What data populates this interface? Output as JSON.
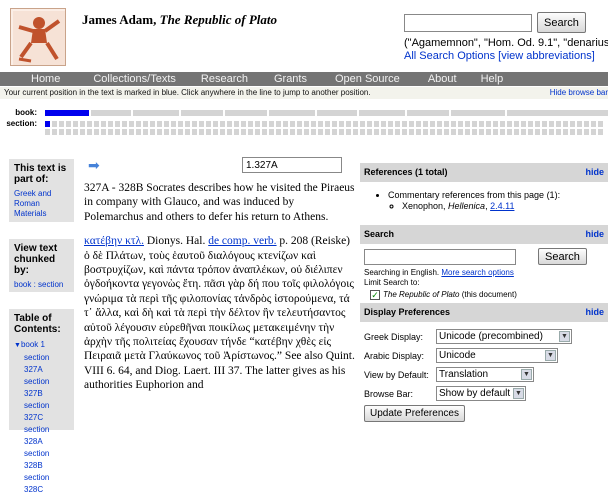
{
  "header": {
    "author": "James Adam, ",
    "work": "The Republic of Plato",
    "search_button": "Search",
    "search_example": "(\"Agamemnon\", \"Hom. Od. 9.1\", \"denarius\")",
    "all_search_options": "All Search Options",
    "view_abbreviations": "[view abbreviations]"
  },
  "nav": [
    "Home",
    "Collections/Texts",
    "Research",
    "Grants",
    "Open Source",
    "About",
    "Help"
  ],
  "position_hint": "Your current position in the text is marked in blue. Click anywhere in the line to jump to another position.",
  "hide_browse_bar": "Hide browse bar",
  "browse": {
    "book_label": "book:",
    "section_label": "section:"
  },
  "left": {
    "part_of_title": "This text is part of:",
    "part_of_link": "Greek and Roman Materials",
    "chunked_title": "View text chunked by:",
    "chunked_link": "book : section",
    "toc_title": "Table of Contents:",
    "toc_book": "book 1",
    "toc_sections": [
      "section 327A",
      "section 327B",
      "section 327C",
      "section 328A",
      "section 328B",
      "section 328C"
    ]
  },
  "main": {
    "jump_value": "1.327A",
    "summary": "327A - 328B Socrates describes how he visited the Piraeus in company with Glauco, and was induced by Polemarchus and others to defer his return to Athens.",
    "lemma": "κατέβην κτλ.",
    "ref_pre": " Dionys. Hal. ",
    "ref_link": "de comp. verb.",
    "ref_post": " p. 208 (Reiske) ",
    "greek": "ὁ δὲ Πλάτων, τοὺς ἑαυτοῦ διαλόγους κτενίζων καὶ βοστρυχίζων, καὶ πάντα τρόπον ἀναπλέκων, οὐ διέλιπεν ὀγδοήκοντα γεγονὼς ἔτη. πᾶσι γὰρ δή που τοῖς φιλολόγοις γνώριμα τὰ περὶ τῆς φιλοπονίας τἀνδρὸς ἱστορούμενα, τά τ᾽ ἄλλα, καὶ δὴ καὶ τὰ περὶ τὴν δέλτον ἣν τελευτήσαντος αὐτοῦ λέγουσιν εὑρεθῆναι ποικίλως μετακειμένην τὴν ἀρχὴν τῆς πολιτείας ἔχουσαν τήνδε “κατέβην χθὲς εἰς Πειραιᾶ μετὰ Γλαύκωνος τοῦ Ἀρίστωνος.”",
    "after": " See also Quint. VIII 6. 64, and Diog. Laert. III 37. The latter gives as his authorities Euphorion and"
  },
  "right": {
    "refs_title": "References (1 total)",
    "hide": "hide",
    "refs_item": "Commentary references from this page (1):",
    "refs_sub_author": "Xenophon, ",
    "refs_sub_work": "Hellenica",
    "refs_sub_loc": "2.4.11",
    "search_title": "Search",
    "search_button": "Search",
    "searching_in": "Searching in English.",
    "more_options": "More search options",
    "limit_to": "Limit Search to:",
    "limit_work": "The Republic of Plato",
    "limit_suffix": " (this document)",
    "prefs_title": "Display Preferences",
    "prefs": [
      {
        "label": "Greek Display:",
        "value": "Unicode (precombined)"
      },
      {
        "label": "Arabic Display:",
        "value": "Unicode"
      },
      {
        "label": "View by Default:",
        "value": "Translation"
      },
      {
        "label": "Browse Bar:",
        "value": "Show by default"
      }
    ],
    "update_button": "Update Preferences"
  },
  "colors": {
    "nav_bg": "#747474",
    "link": "#0033cc",
    "current_position": "#0000ee",
    "panel_bg": "#e2e2e2"
  },
  "icons": [
    "perseus-logo",
    "right-arrow-icon",
    "checkbox-checked-icon",
    "chevron-down-icon"
  ]
}
